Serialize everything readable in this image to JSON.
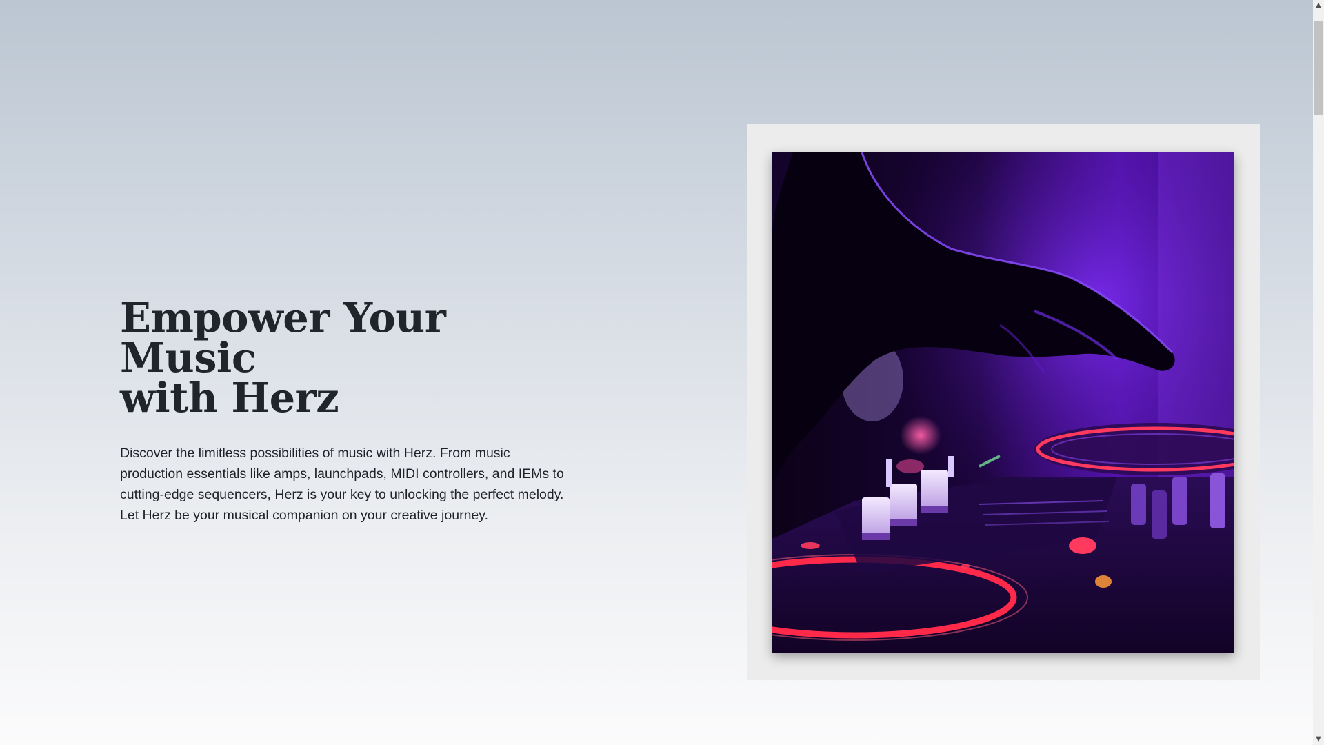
{
  "hero": {
    "title_line1": "Empower Your Music",
    "title_line2": "with Herz",
    "description": "Discover the limitless possibilities of music with Herz. From music production essentials like amps, launchpads, MIDI controllers, and IEMs to cutting-edge sequencers, Herz is your key to unlocking the perfect melody. Let Herz be your musical companion on your creative journey."
  },
  "colors": {
    "heading": "#20242b",
    "background_top": "#bbc6d2",
    "background_bottom": "#fbfbfc",
    "frame": "#ececec",
    "accent_purple": "#6a1fd1",
    "accent_red": "#ff2a4a"
  },
  "scrollbar": {
    "up_icon": "chevron-up-icon",
    "down_icon": "chevron-down-icon"
  }
}
